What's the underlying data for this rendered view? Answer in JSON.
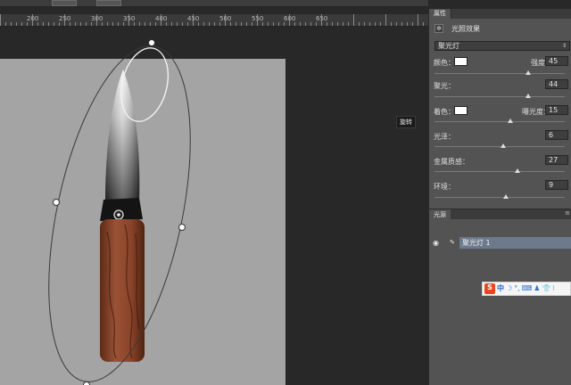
{
  "ruler": {
    "ticks": [
      "200",
      "250",
      "300",
      "350",
      "400",
      "450",
      "500",
      "550",
      "600",
      "650"
    ]
  },
  "tooltip": "旋转",
  "properties": {
    "tab": "属性",
    "effect_title": "光照效果",
    "preset": "聚光灯",
    "color_label": "颜色：",
    "intensity_label": "强度：",
    "intensity": "45",
    "intensity_pct": 0.72,
    "hotspot_label": "聚光：",
    "hotspot": "44",
    "hotspot_pct": 0.72,
    "colorize_label": "着色：",
    "exposure_label": "曝光度：",
    "exposure": "15",
    "exposure_pct": 0.58,
    "gloss_label": "光泽：",
    "gloss": "6",
    "gloss_pct": 0.53,
    "metallic_label": "金属质感：",
    "metallic": "27",
    "metallic_pct": 0.64,
    "ambience_label": "环境：",
    "ambience": "9",
    "ambience_pct": 0.55
  },
  "lights_panel": {
    "tab": "光源",
    "light_name": "聚光灯 1"
  },
  "ime": {
    "logo": "S",
    "lang": "中",
    "items": [
      "☽",
      "°,",
      "⌨",
      "♟",
      "👕",
      "⁝"
    ]
  },
  "colors": {
    "doc_bg": "#a4a4a4",
    "panel": "#535353",
    "selection": "#6c7a8c",
    "handle": "#8b4a30"
  }
}
